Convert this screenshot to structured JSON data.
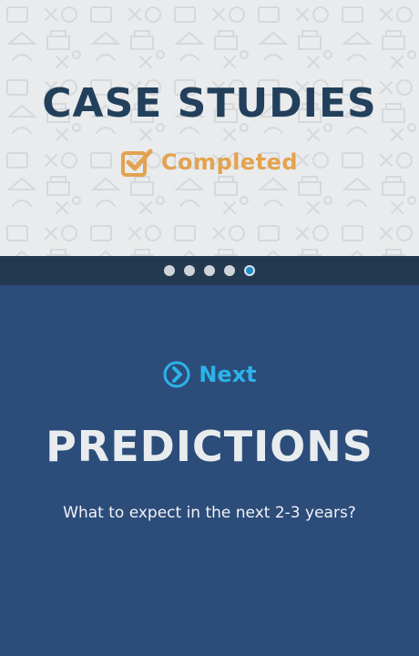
{
  "hero": {
    "title": "CASE STUDIES",
    "status_label": "Completed",
    "status_icon": "checkbox-checked-icon",
    "background_pattern": "school-doodle-pattern"
  },
  "pager": {
    "total": 5,
    "active_index": 4
  },
  "next": {
    "label": "Next",
    "icon": "chevron-right-circle-icon",
    "title": "PREDICTIONS",
    "description": "What to expect in the next 2-3 years?"
  },
  "colors": {
    "hero_background": "#e9ebec",
    "hero_title": "#22405b",
    "completed_accent": "#e3a250",
    "pager_background": "#23394f",
    "active_dot": "#1e8ec7",
    "panel_background": "#2c4c7a",
    "next_accent": "#2bb3ea",
    "panel_text": "#e8ecef"
  }
}
